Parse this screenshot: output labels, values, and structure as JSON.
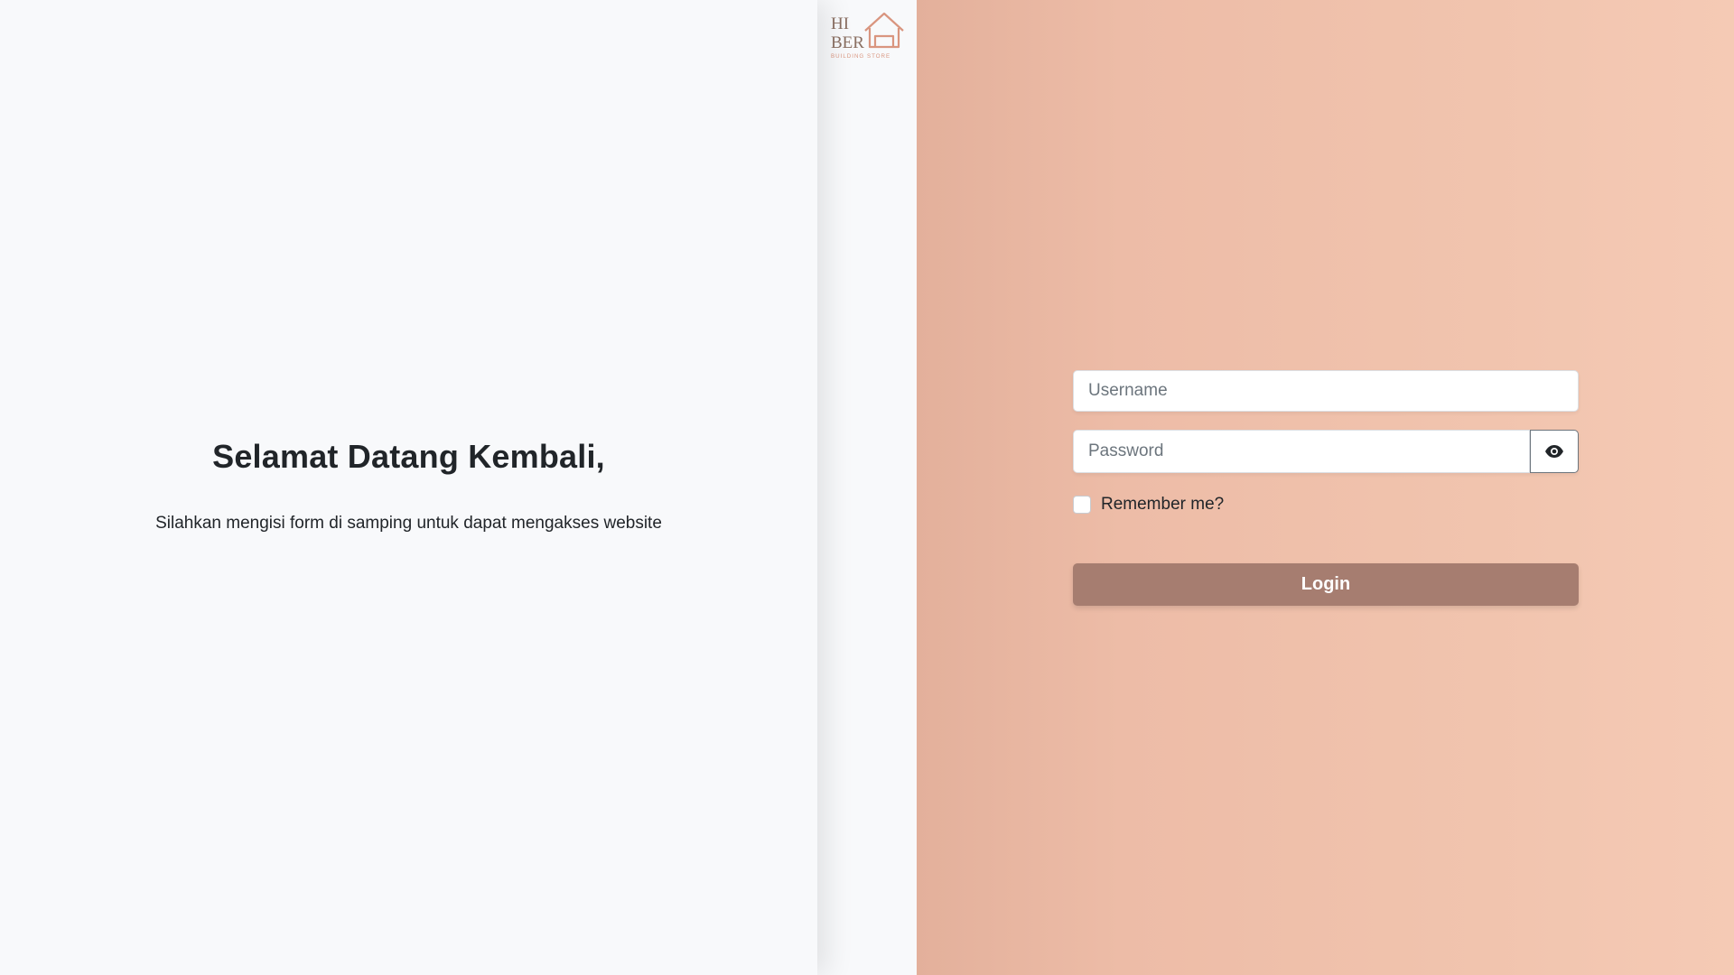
{
  "welcome": {
    "title": "Selamat Datang Kembali,",
    "subtitle": "Silahkan mengisi form di samping untuk dapat mengakses website"
  },
  "logo": {
    "line1": "HI",
    "line2": "BER",
    "tagline": "BUILDING STORE",
    "icon": "house-icon",
    "color": "#d9957f"
  },
  "form": {
    "username_placeholder": "Username",
    "username_value": "",
    "password_placeholder": "Password",
    "password_value": "",
    "toggle_icon": "eye-icon",
    "remember_label": "Remember me?",
    "remember_checked": false,
    "login_label": "Login"
  },
  "colors": {
    "accent": "#a67d70",
    "panel_left": "#f8f9fb",
    "gradient_start": "#e3b09b",
    "gradient_end": "#f5cab5",
    "text": "#212529"
  }
}
